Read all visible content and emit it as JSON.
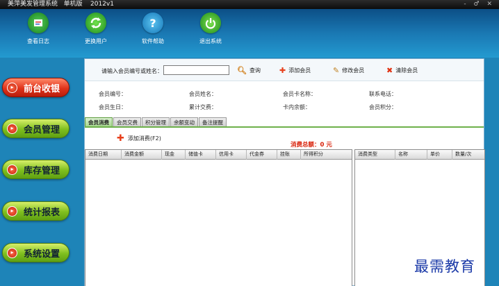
{
  "window": {
    "title": "美萍美发管理系统   单机版    2012v1",
    "controls": "- ♂ ✕"
  },
  "toolbar": [
    {
      "label": "查看日志",
      "icon": "log-icon",
      "color": "#1a8a2a"
    },
    {
      "label": "更换用户",
      "icon": "switch-user-icon",
      "color": "#2aa020"
    },
    {
      "label": "软件帮助",
      "icon": "help-icon",
      "color": "#1f9ed8"
    },
    {
      "label": "退出系统",
      "icon": "power-icon",
      "color": "#2aa020"
    }
  ],
  "nav": [
    {
      "label": "前台收银",
      "active": true
    },
    {
      "label": "会员管理",
      "active": false
    },
    {
      "label": "库存管理",
      "active": false
    },
    {
      "label": "统计报表",
      "active": false
    },
    {
      "label": "系统设置",
      "active": false
    }
  ],
  "search": {
    "label": "请输入会员编号或姓名：",
    "value": "",
    "query_button": "查询",
    "add_member_button": "添加会员",
    "edit_member_button": "修改会员",
    "clear_member_button": "清除会员"
  },
  "member_info": {
    "id_label": "会员编号：",
    "name_label": "会员姓名：",
    "card_name_label": "会员卡名称：",
    "phone_label": "联系电话：",
    "birthday_label": "会员生日：",
    "total_spent_label": "累计交费：",
    "balance_label": "卡内余额：",
    "points_label": "会员积分："
  },
  "tabs": [
    "会员消费",
    "会员交费",
    "积分管理",
    "余额变动",
    "备注提醒"
  ],
  "add_consume_button": "添加消费(F2)",
  "total_consumption": "消费总额：0 元",
  "left_grid": {
    "columns": [
      "消费日期",
      "消费金额",
      "现金",
      "储值卡",
      "信用卡",
      "代金券",
      "挂账",
      "所得积分"
    ]
  },
  "right_grid": {
    "columns": [
      "消费类型",
      "名称",
      "单价",
      "数量/次"
    ]
  },
  "watermark": "最需教育"
}
